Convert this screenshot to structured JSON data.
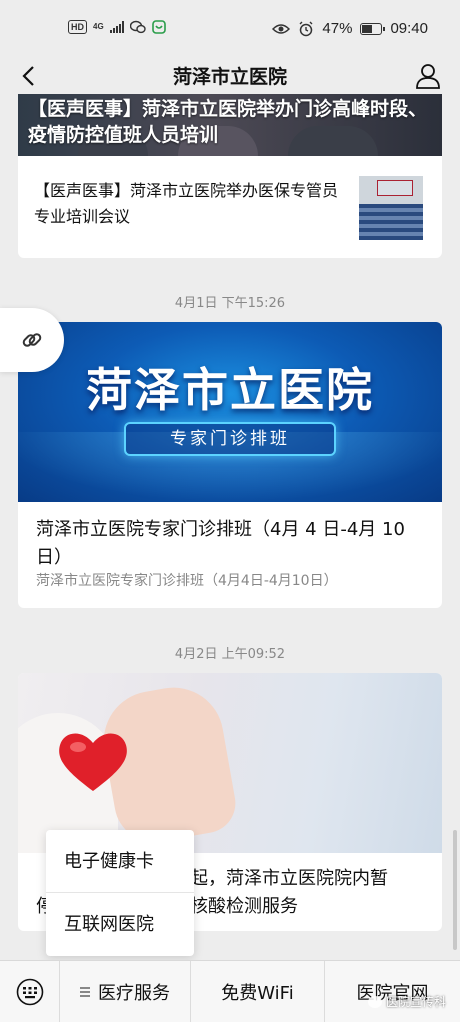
{
  "status_bar": {
    "hd": "HD",
    "network": "4G",
    "battery_percent": "47%",
    "battery_level": 0.47,
    "time": "09:40",
    "icons": [
      "wechat-icon",
      "app-icon",
      "eye-icon",
      "alarm-icon",
      "battery-icon",
      "signal-icon"
    ]
  },
  "nav": {
    "title": "菏泽市立医院",
    "back_icon": "chevron-left-icon",
    "profile_icon": "person-icon"
  },
  "articles": [
    {
      "banner_title": "【医声医事】菏泽市立医院举办门诊高峰时段、疫情防控值班人员培训",
      "sub_title": "【医声医事】菏泽市立医院举办医保专管员专业培训会议"
    }
  ],
  "timestamps": [
    "4月1日 下午15:26",
    "4月2日 上午09:52"
  ],
  "card2": {
    "banner_title": "菏泽市立医院",
    "banner_sub": "专家门诊排班",
    "title": "菏泽市立医院专家门诊排班（4月 4 日-4月 10日）",
    "desc": "菏泽市立医院专家门诊排班（4月4日-4月10日）"
  },
  "card3": {
    "title": "【…日起，菏泽市立医院院内暂停…员核酸检测服务",
    "title_line1": "【",
    "title_line1b": "日起，菏泽市立医院院内暂",
    "title_line2": "停",
    "title_line2b": "员核酸检测服务"
  },
  "popup": {
    "items": [
      "电子健康卡",
      "互联网医院"
    ]
  },
  "bottom_menu": {
    "keyboard_icon": "keyboard-icon",
    "items": [
      "医疗服务",
      "免费WiFi",
      "医院官网"
    ]
  },
  "watermark": "医院宣传科",
  "link_icon": "link-icon"
}
